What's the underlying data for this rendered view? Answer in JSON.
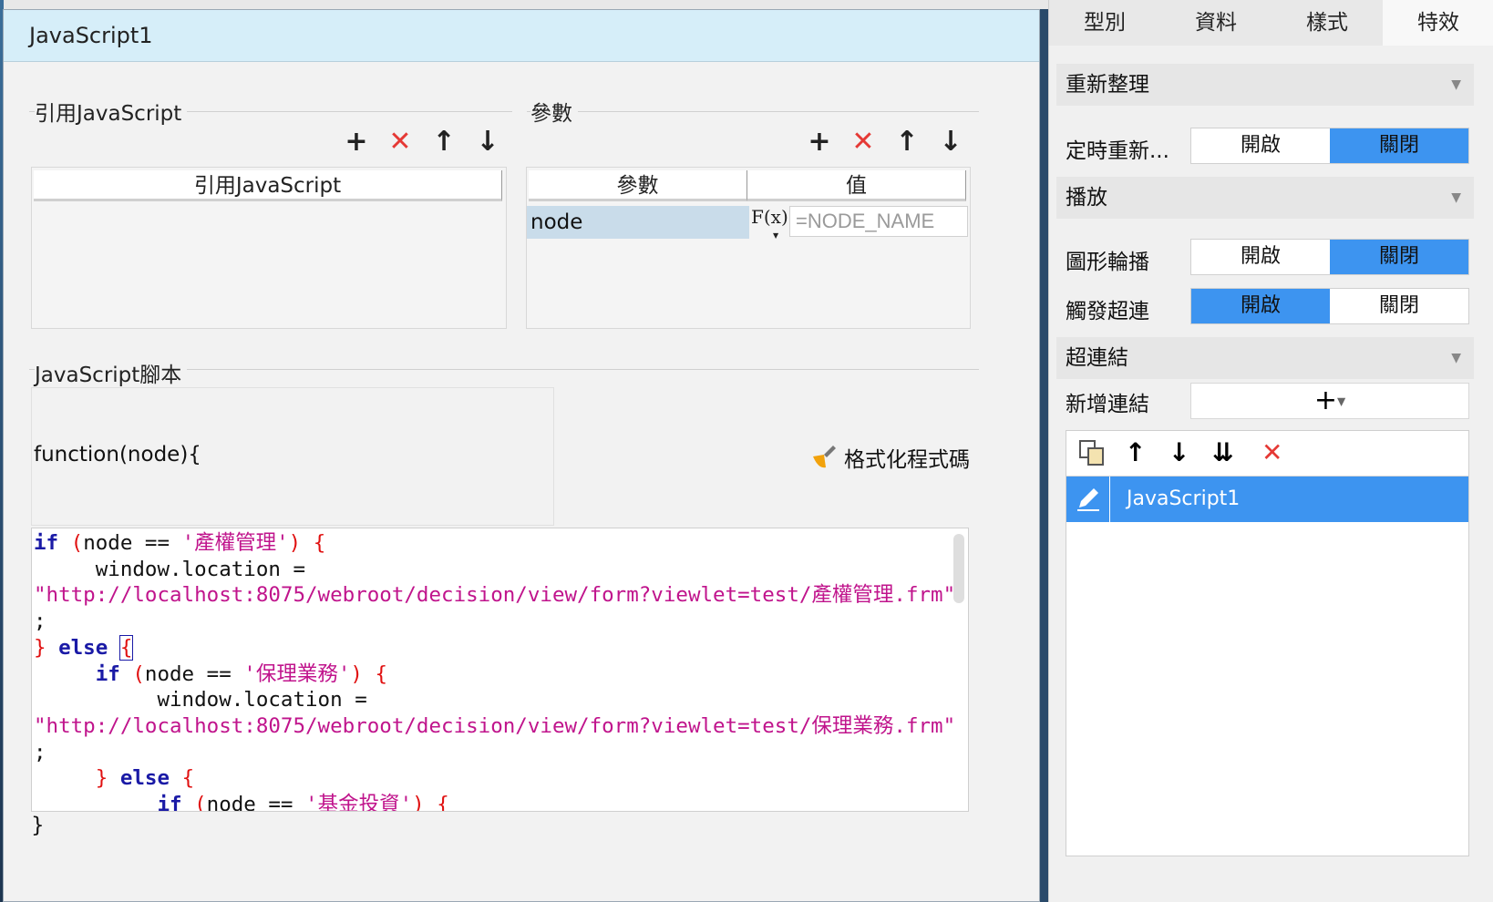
{
  "dialog": {
    "title": "JavaScript1",
    "ref_js": {
      "section_label": "引用JavaScript",
      "column_header": "引用JavaScript"
    },
    "params": {
      "section_label": "參數",
      "columns": [
        "參數",
        "值"
      ],
      "rows": [
        {
          "name": "node",
          "fx": "F(x)",
          "value_placeholder": "=NODE_NAME"
        }
      ]
    },
    "script": {
      "section_label": "JavaScript腳本",
      "signature": "function(node){",
      "format_button": "格式化程式碼",
      "closing": "}",
      "code_lines": [
        "if (node == '產權管理') {",
        "     window.location =",
        "\"http://localhost:8075/webroot/decision/view/form?viewlet=test/產權管理.frm\"",
        ";",
        "} else {",
        "     if (node == '保理業務') {",
        "          window.location =",
        "\"http://localhost:8075/webroot/decision/view/form?viewlet=test/保理業務.frm\"",
        ";",
        "     } else {",
        "          if (node == '基金投資') {"
      ]
    },
    "toolbar_icons": [
      "plus-icon",
      "delete-x-icon",
      "arrow-up-icon",
      "arrow-down-icon"
    ]
  },
  "panel": {
    "tabs": [
      "型別",
      "資料",
      "樣式",
      "特效"
    ],
    "active_tab": "特效",
    "refresh": {
      "title": "重新整理",
      "timer_label": "定時重新...",
      "options": [
        "開啟",
        "關閉"
      ],
      "selected": "關閉"
    },
    "play": {
      "title": "播放",
      "carousel_label": "圖形輪播",
      "carousel_selected": "關閉",
      "trigger_label": "觸發超連",
      "trigger_selected": "開啟",
      "options": [
        "開啟",
        "關閉"
      ]
    },
    "hyperlink": {
      "title": "超連結",
      "add_label": "新增連結",
      "add_symbol": "+",
      "items": [
        "JavaScript1"
      ]
    },
    "colors": {
      "accent": "#3d94f0",
      "delete": "#e53935"
    }
  }
}
